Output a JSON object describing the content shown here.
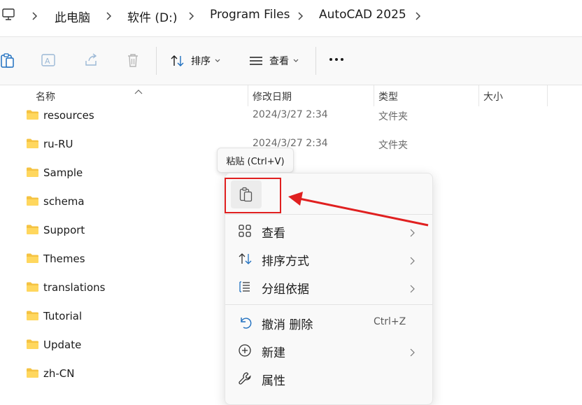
{
  "breadcrumb": {
    "items": [
      "此电脑",
      "软件 (D:)",
      "Program Files",
      "AutoCAD 2025"
    ]
  },
  "toolbar": {
    "sort_label": "排序",
    "view_label": "查看"
  },
  "columns": {
    "name": "名称",
    "date": "修改日期",
    "type": "类型",
    "size": "大小"
  },
  "files": [
    {
      "name": "resources",
      "date": "2024/3/27 2:34",
      "type": "文件夹"
    },
    {
      "name": "ru-RU",
      "date": "2024/3/27 2:34",
      "type": "文件夹"
    },
    {
      "name": "Sample",
      "date": "",
      "type": ""
    },
    {
      "name": "schema",
      "date": "",
      "type": ""
    },
    {
      "name": "Support",
      "date": "",
      "type": ""
    },
    {
      "name": "Themes",
      "date": "",
      "type": ""
    },
    {
      "name": "translations",
      "date": "",
      "type": ""
    },
    {
      "name": "Tutorial",
      "date": "",
      "type": ""
    },
    {
      "name": "Update",
      "date": "",
      "type": ""
    },
    {
      "name": "zh-CN",
      "date": "",
      "type": ""
    }
  ],
  "tooltip": {
    "text": "粘贴 (Ctrl+V)"
  },
  "context_menu": {
    "view": "查看",
    "sort_by": "排序方式",
    "group_by": "分组依据",
    "undo": "撤消 删除",
    "undo_shortcut": "Ctrl+Z",
    "new": "新建",
    "properties": "属性"
  },
  "colors": {
    "folder": "#f5c342",
    "annotation_red": "#e02020"
  }
}
